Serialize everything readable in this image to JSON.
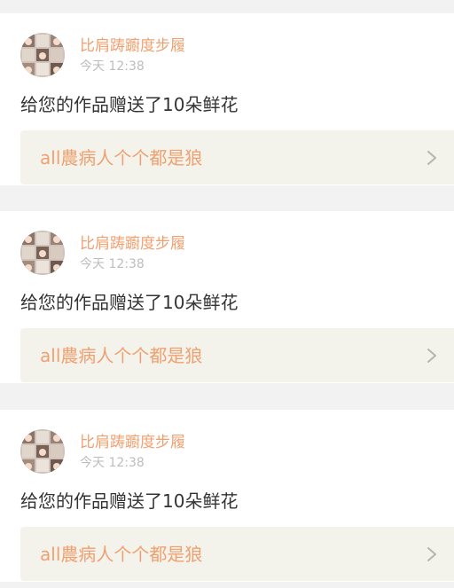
{
  "notifications": [
    {
      "username": "比肩踌躕度步履",
      "time": "今天 12:38",
      "message": "给您的作品赠送了10朵鲜花",
      "work_title": "all農病人个个都是狼"
    },
    {
      "username": "比肩踌躕度步履",
      "time": "今天 12:38",
      "message": "给您的作品赠送了10朵鲜花",
      "work_title": "all農病人个个都是狼"
    },
    {
      "username": "比肩踌躕度步履",
      "time": "今天 12:38",
      "message": "给您的作品赠送了10朵鲜花",
      "work_title": "all農病人个个都是狼"
    }
  ],
  "colors": {
    "accent": "#f0a070",
    "link_background": "#f3f3ec",
    "page_background": "#f2f2f2"
  },
  "icons": {
    "chevron": "chevron-right-icon"
  }
}
